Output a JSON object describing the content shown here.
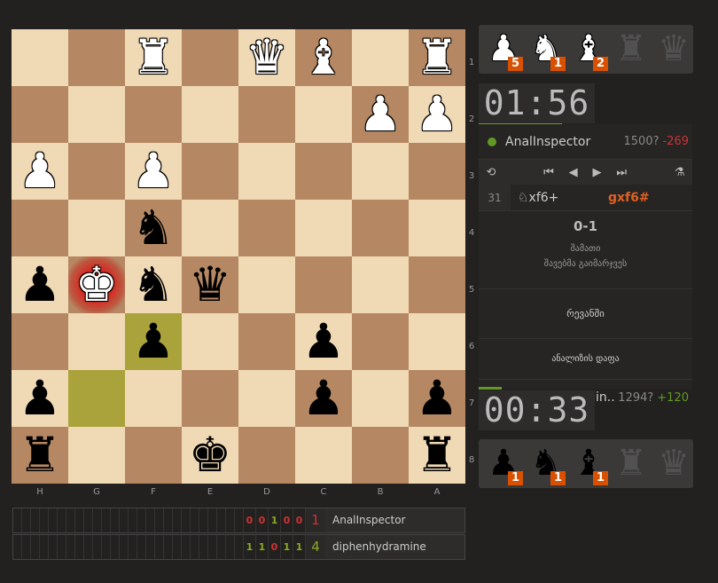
{
  "board": {
    "light": "#f0d9b5",
    "dark": "#b58863",
    "highlight": "#aaa23a",
    "check_square": "g5",
    "last_move": [
      "g7",
      "f6"
    ],
    "ranks": [
      "1",
      "2",
      "3",
      "4",
      "5",
      "6",
      "7",
      "8"
    ],
    "files": [
      "H",
      "G",
      "F",
      "E",
      "D",
      "C",
      "B",
      "A"
    ],
    "pieces": [
      {
        "sq": "f1",
        "glyph": "♜",
        "color": "white",
        "name": "white-rook-icon"
      },
      {
        "sq": "d1",
        "glyph": "♛",
        "color": "white",
        "name": "white-queen-icon"
      },
      {
        "sq": "c1",
        "glyph": "♝",
        "color": "white",
        "name": "white-bishop-icon"
      },
      {
        "sq": "a1",
        "glyph": "♜",
        "color": "white",
        "name": "white-rook-icon"
      },
      {
        "sq": "b2",
        "glyph": "♟",
        "color": "white",
        "name": "white-pawn-icon"
      },
      {
        "sq": "a2",
        "glyph": "♟",
        "color": "white",
        "name": "white-pawn-icon"
      },
      {
        "sq": "h3",
        "glyph": "♟",
        "color": "white",
        "name": "white-pawn-icon"
      },
      {
        "sq": "f3",
        "glyph": "♟",
        "color": "white",
        "name": "white-pawn-icon"
      },
      {
        "sq": "f4",
        "glyph": "♞",
        "color": "black",
        "name": "black-knight-icon"
      },
      {
        "sq": "h5",
        "glyph": "♟",
        "color": "black",
        "name": "black-pawn-icon"
      },
      {
        "sq": "g5",
        "glyph": "♚",
        "color": "white",
        "name": "white-king-icon"
      },
      {
        "sq": "f5",
        "glyph": "♞",
        "color": "black",
        "name": "black-knight-icon"
      },
      {
        "sq": "e5",
        "glyph": "♛",
        "color": "black",
        "name": "black-queen-icon"
      },
      {
        "sq": "f6",
        "glyph": "♟",
        "color": "black",
        "name": "black-pawn-icon"
      },
      {
        "sq": "c6",
        "glyph": "♟",
        "color": "black",
        "name": "black-pawn-icon"
      },
      {
        "sq": "h7",
        "glyph": "♟",
        "color": "black",
        "name": "black-pawn-icon"
      },
      {
        "sq": "c7",
        "glyph": "♟",
        "color": "black",
        "name": "black-pawn-icon"
      },
      {
        "sq": "a7",
        "glyph": "♟",
        "color": "black",
        "name": "black-pawn-icon"
      },
      {
        "sq": "h8",
        "glyph": "♜",
        "color": "black",
        "name": "black-rook-icon"
      },
      {
        "sq": "e8",
        "glyph": "♚",
        "color": "black",
        "name": "black-king-icon"
      },
      {
        "sq": "a8",
        "glyph": "♜",
        "color": "black",
        "name": "black-rook-icon"
      }
    ]
  },
  "top_pocket": [
    {
      "glyph": "♟",
      "count": "5",
      "color": "white",
      "name": "pocket-pawn-icon"
    },
    {
      "glyph": "♞",
      "count": "1",
      "color": "white",
      "name": "pocket-knight-icon"
    },
    {
      "glyph": "♝",
      "count": "2",
      "color": "white",
      "name": "pocket-bishop-icon"
    },
    {
      "glyph": "♜",
      "count": "",
      "color": "dim",
      "name": "pocket-rook-icon"
    },
    {
      "glyph": "♛",
      "count": "",
      "color": "dim",
      "name": "pocket-queen-icon"
    }
  ],
  "bottom_pocket": [
    {
      "glyph": "♟",
      "count": "1",
      "color": "black",
      "name": "pocket-pawn-icon"
    },
    {
      "glyph": "♞",
      "count": "1",
      "color": "black",
      "name": "pocket-knight-icon"
    },
    {
      "glyph": "♝",
      "count": "1",
      "color": "black",
      "name": "pocket-bishop-icon"
    },
    {
      "glyph": "♜",
      "count": "",
      "color": "dim",
      "name": "pocket-rook-icon"
    },
    {
      "glyph": "♛",
      "count": "",
      "color": "dim",
      "name": "pocket-queen-icon"
    }
  ],
  "top_clock": {
    "min": "01",
    "colon": ":",
    "sec": "56"
  },
  "bottom_clock": {
    "min": "00",
    "colon": ":",
    "sec": "33"
  },
  "top_player": {
    "name": "AnalInspector",
    "rating": "1500?",
    "diff": "-269"
  },
  "bottom_player": {
    "name": "diphenhydramin..",
    "rating": "1294?",
    "diff": "+120"
  },
  "controls": {
    "flip": "⟲",
    "first": "⏮",
    "prev": "◀",
    "next": "▶",
    "last": "⏭",
    "analysis": "⚗"
  },
  "move": {
    "number": "31",
    "white": "♘xf6+",
    "black": "gxf6#"
  },
  "result": {
    "score": "0-1",
    "line1": "შამათი",
    "line2": "შავებმა გაიმარჯვეს"
  },
  "rematch_label": "რევანში",
  "analysis_label": "ანალიზის დაფა",
  "scoreboard": [
    {
      "cells": [
        "",
        "",
        "",
        "",
        "",
        "",
        "",
        "",
        "",
        "",
        "",
        "",
        "",
        "",
        "",
        "",
        "",
        "",
        "",
        "",
        "",
        "",
        "",
        "",
        "",
        "",
        "0",
        "0",
        "1",
        "0",
        "0"
      ],
      "total": "1",
      "name": "AnalInspector",
      "total_color": "#cc3333"
    },
    {
      "cells": [
        "",
        "",
        "",
        "",
        "",
        "",
        "",
        "",
        "",
        "",
        "",
        "",
        "",
        "",
        "",
        "",
        "",
        "",
        "",
        "",
        "",
        "",
        "",
        "",
        "",
        "",
        "1",
        "1",
        "0",
        "1",
        "1"
      ],
      "total": "4",
      "name": "diphenhydramine",
      "total_color": "#8aaa22"
    }
  ]
}
